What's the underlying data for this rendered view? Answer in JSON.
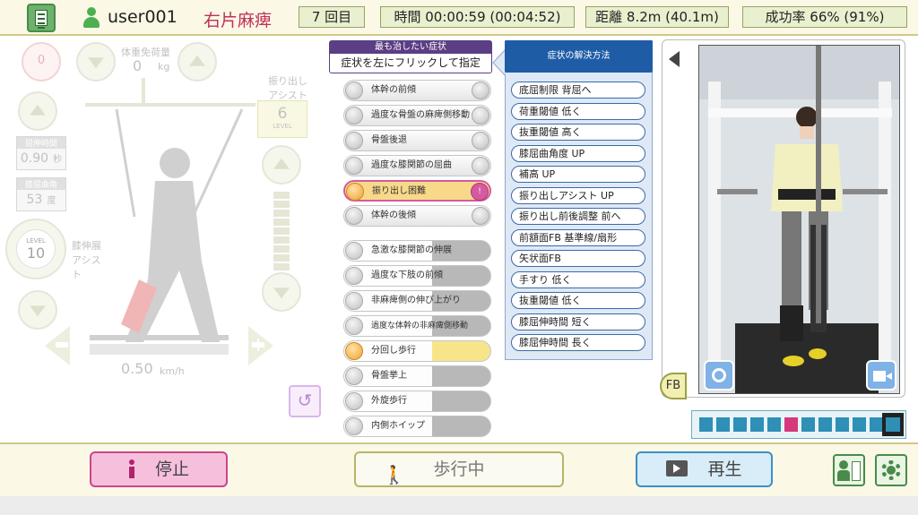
{
  "header": {
    "user": "user001",
    "condition": "右片麻痺",
    "session": "7 回目",
    "time": "時間 00:00:59 (00:04:52)",
    "distance": "距離 8.2m (40.1m)",
    "success_rate": "成功率 66% (91%)"
  },
  "left_panel": {
    "body_weight_label": "体重免荷量",
    "body_weight_value": "0",
    "body_weight_unit": "kg",
    "load_badge": "0",
    "swing_assist_label": "振り出し アシスト",
    "swing_level": "6",
    "level_word": "LEVEL",
    "flex_time_label": "屈伸時間",
    "flex_time_value": "0.90",
    "flex_time_unit": "秒",
    "flex_angle_label": "膝屈曲角",
    "flex_angle_value": "53",
    "flex_angle_unit": "度",
    "knee_level_word": "LEVEL",
    "knee_level": "10",
    "knee_assist_label": "膝伸展 アシスト",
    "speed": "0.50",
    "speed_unit": "km/h"
  },
  "symptoms": {
    "header_title": "最も治したい症状",
    "header_sub": "症状を左にフリックして指定",
    "items": [
      "体幹の前傾",
      "過度な骨盤の麻痺側移動",
      "骨盤後退",
      "過度な膝関節の屈曲",
      "振り出し困難",
      "体幹の後傾",
      "急激な膝関節の伸展",
      "過度な下肢の前傾",
      "非麻痺側の伸び上がり",
      "過度な体幹の非麻痺側移動",
      "分回し歩行",
      "骨盤挙上",
      "外旋歩行",
      "内側ホイップ"
    ],
    "selected_badge": "!"
  },
  "solutions": {
    "header": "症状の解決方法",
    "items": [
      "底屈制限 背屈へ",
      "荷重閾値 低く",
      "抜重閾値 高く",
      "膝屈曲角度 UP",
      "補高 UP",
      "振り出しアシスト UP",
      "振り出し前後調整 前へ",
      "前額面FB 基準線/扇形",
      "矢状面FB",
      "手すり 低く",
      "抜重閾値 低く",
      "膝屈伸時間 短く",
      "膝屈伸時間 長く"
    ]
  },
  "video": {
    "fb_label": "FB",
    "timeline_count": 11,
    "timeline_active": 5
  },
  "buttons": {
    "stop": "停止",
    "walking": "歩行中",
    "play": "再生"
  },
  "colors": {
    "accent_green": "#4caf50",
    "selected_pink": "#d65aa0",
    "solution_blue": "#1e5da6",
    "stop_pink": "#f6c0dc",
    "condition_red": "#c0305a"
  }
}
